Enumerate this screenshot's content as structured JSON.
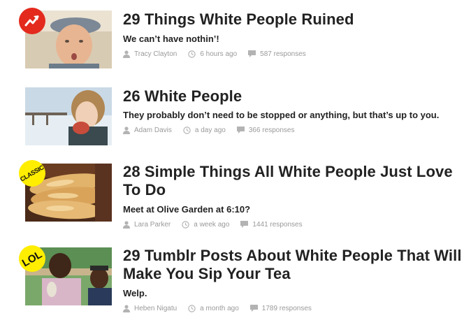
{
  "articles": [
    {
      "title": "29 Things White People Ruined",
      "subtitle": "We can’t have nothin’!",
      "author": "Tracy Clayton",
      "time": "6 hours ago",
      "responses": "587 responses",
      "badge": "trending"
    },
    {
      "title": "26 White People",
      "subtitle": "They probably don’t need to be stopped or anything, but that’s up to you.",
      "author": "Adam Davis",
      "time": "a day ago",
      "responses": "366 responses",
      "badge": ""
    },
    {
      "title": "28 Simple Things All White People Just Love To Do",
      "subtitle": "Meet at Olive Garden at 6:10?",
      "author": "Lara Parker",
      "time": "a week ago",
      "responses": "1441 responses",
      "badge": "CLASSIC"
    },
    {
      "title": "29 Tumblr Posts About White People That Will Make You Sip Your Tea",
      "subtitle": "Welp.",
      "author": "Heben Nigatu",
      "time": "a month ago",
      "responses": "1789 responses",
      "badge": "LOL"
    }
  ],
  "colors": {
    "trending_badge": "#e32a1d",
    "yellow_badge": "#ffee00",
    "meta_text": "#9a9a9a",
    "title_text": "#222222"
  },
  "icons": {
    "author": "user-icon",
    "time": "clock-icon",
    "responses": "comment-icon",
    "trending": "trending-arrow-icon"
  }
}
